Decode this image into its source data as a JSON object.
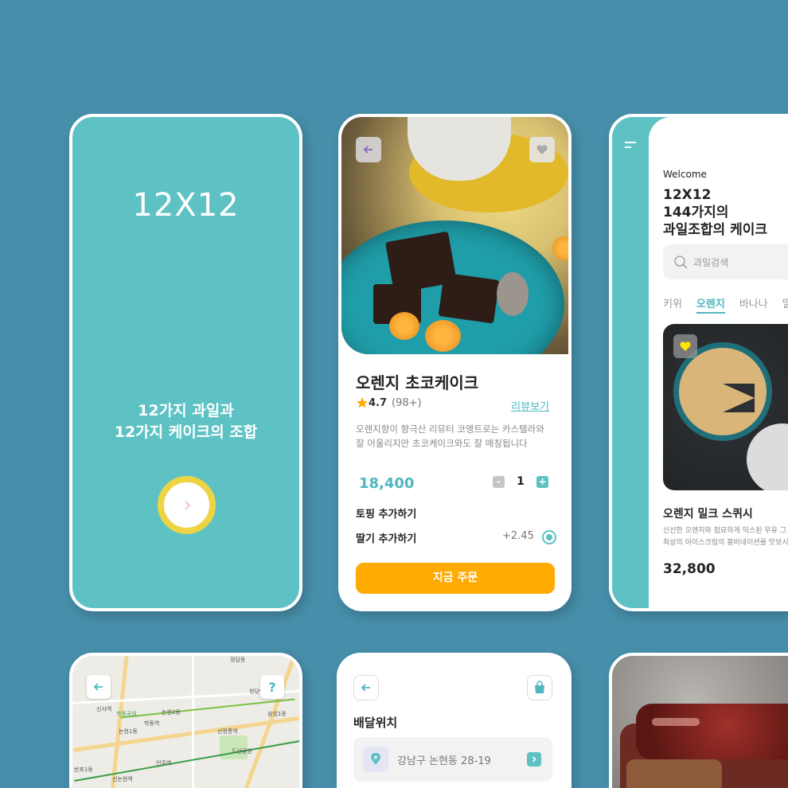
{
  "colors": {
    "background": "#468ea9",
    "teal": "#5ec2c4",
    "accent_teal": "#4fb6c0",
    "yellow": "#ecd444",
    "orange_button": "#ffaa00"
  },
  "splash": {
    "brand": "12X12",
    "tagline_line1": "12가지 과일과",
    "tagline_line2": "12가지 케이크의 조합",
    "next_icon": "chevron-right-icon"
  },
  "detail": {
    "title": "오렌지 초코케이크",
    "rating": "4.7",
    "rating_count": "(98+)",
    "review_link": "리뷰보기",
    "description": "오렌지향이 향극산 리뮤터 코엥트로는 카스텔라와 잘 어울리지만 초코케이크와도 잘 매칭됩니다",
    "price": "18,400",
    "quantity": "1",
    "minus_label": "-",
    "plus_label": "+",
    "topping_label": "토핑 추가하기",
    "option_label": "딸기 추가하기",
    "option_price": "+2.45",
    "order_button": "지금 주문"
  },
  "home": {
    "welcome": "Welcome",
    "headline_line1": "12X12",
    "headline_line2": "144가지의",
    "headline_line3": "과일조합의 케이크",
    "search_placeholder": "과일검색",
    "tabs": [
      "키위",
      "오렌지",
      "바나나",
      "딸"
    ],
    "active_tab": 1,
    "product_name": "오렌지 밀크 스퀴시",
    "product_desc_line1": "신선한 오렌지와 첨묘하게 믹스된 우유 그",
    "product_desc_line2": "최상의 아이스크림의 흥비네이션를 맛보시",
    "product_price": "32,800"
  },
  "map": {
    "help_label": "?",
    "labels": [
      "정담동",
      "신사역",
      "학동공원",
      "논현1동",
      "학동역",
      "논현2동",
      "신논현역",
      "언주역",
      "반포1동",
      "선정릉역",
      "삼성1동",
      "청담역",
      "도산공원"
    ]
  },
  "delivery": {
    "title": "배달위치",
    "address": "강남구 논현동 28-19"
  }
}
